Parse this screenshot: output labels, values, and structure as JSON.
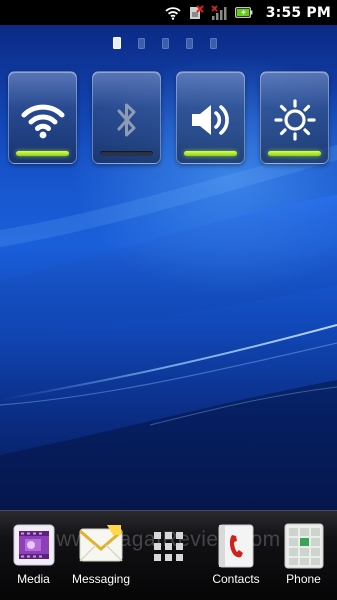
{
  "status_bar": {
    "time": "3:55 PM",
    "icons": [
      "wifi-signal-icon",
      "sim-missing-icon",
      "no-signal-icon",
      "battery-charging-icon"
    ]
  },
  "home": {
    "page_count": 5,
    "active_page": 1
  },
  "toggles": [
    {
      "icon": "wifi-icon",
      "on": true
    },
    {
      "icon": "bluetooth-icon",
      "on": false
    },
    {
      "icon": "sound-icon",
      "on": true
    },
    {
      "icon": "brightness-icon",
      "on": true
    }
  ],
  "dock": {
    "items": [
      {
        "label": "Media",
        "icon": "media-icon"
      },
      {
        "label": "Messaging",
        "icon": "messaging-icon"
      },
      {
        "label": "",
        "icon": "app-drawer-icon"
      },
      {
        "label": "Contacts",
        "icon": "contacts-icon"
      },
      {
        "label": "Phone",
        "icon": "phone-dialpad-icon"
      }
    ],
    "watermark": "www.JagatReview.com"
  },
  "colors": {
    "toggle_on": "#a6e21c",
    "toggle_off": "#2a3346",
    "status_bar_bg": "#000000",
    "wallpaper_blue": "#1a5fda"
  }
}
